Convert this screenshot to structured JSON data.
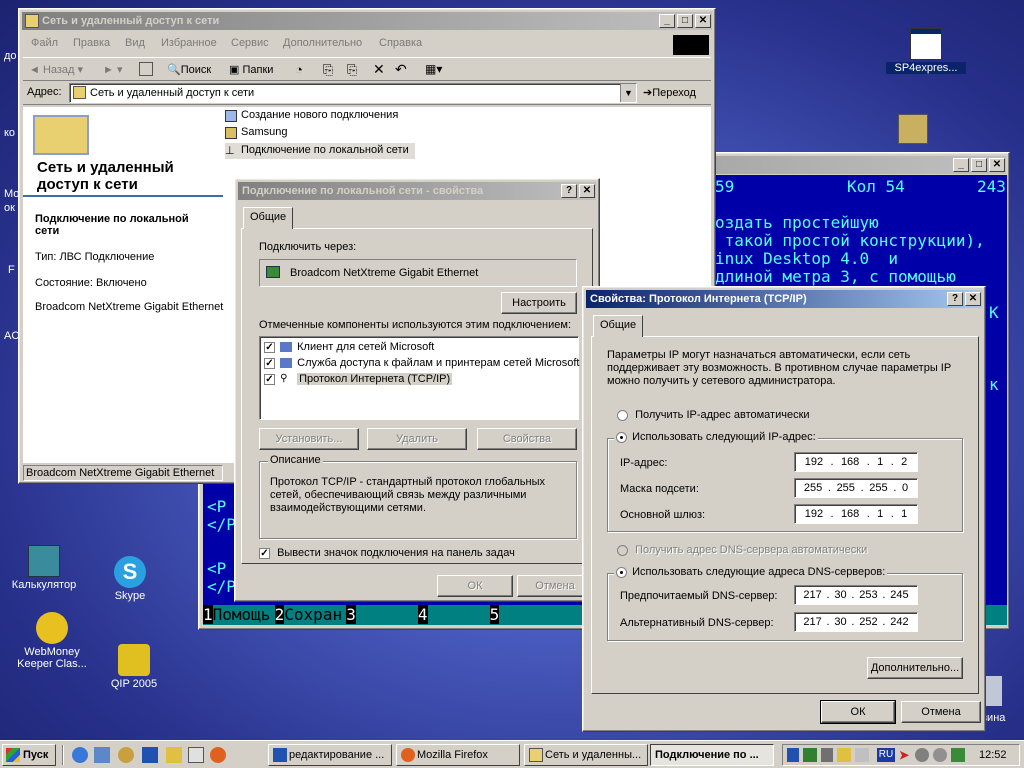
{
  "desktop": {
    "icons": [
      {
        "label": "SP4expres..."
      },
      {
        "label": "Калькулятор"
      },
      {
        "label": "Skype"
      },
      {
        "label": "WebMoney Keeper Clas..."
      },
      {
        "label": "QIP 2005"
      },
      {
        "label": "зина"
      }
    ],
    "left_edge_labels": [
      "до",
      "ко",
      "Мо",
      "ок",
      "F",
      "AC"
    ]
  },
  "explorer": {
    "title": "Сеть и удаленный доступ к сети",
    "menu": [
      "Файл",
      "Правка",
      "Вид",
      "Избранное",
      "Сервис",
      "Дополнительно",
      "Справка"
    ],
    "toolbar": {
      "back": "Назад",
      "search": "Поиск",
      "folders": "Папки"
    },
    "address_label": "Адрес:",
    "address_value": "Сеть и удаленный доступ к сети",
    "go_label": "Переход",
    "panel_title": "Сеть и удаленный доступ к сети",
    "selected_name": "Подключение по локальной сети",
    "type_line": "Тип: ЛВС Подключение",
    "state_line": "Состояние: Включено",
    "adapter_line": "Broadcom NetXtreme Gigabit Ethernet",
    "items": [
      {
        "label": "Создание нового подключения"
      },
      {
        "label": "Samsung"
      },
      {
        "label": "Подключение по локальной сети"
      }
    ],
    "status_text": "Broadcom NetXtreme Gigabit Ethernet"
  },
  "editor": {
    "status_line": {
      "pos": "59",
      "col": "Кол 54",
      "num": "243"
    },
    "lines": [
      "оздать простейшую",
      " такой простой конструкции),",
      "inux Desktop 4.0  и",
      "длиной метра 3, с помощью"
    ],
    "tag_lines": [
      "<P",
      "</P",
      "<P",
      "</P"
    ],
    "side_chars": [
      "К",
      "к"
    ],
    "fkeys": [
      {
        "num": "1",
        "label": "Помощь"
      },
      {
        "num": "2",
        "label": "Сохран"
      },
      {
        "num": "3",
        "label": ""
      },
      {
        "num": "4",
        "label": ""
      },
      {
        "num": "5",
        "label": ""
      }
    ]
  },
  "lan_props": {
    "title": "Подключение по локальной сети - свойства",
    "tab": "Общие",
    "connect_via_label": "Подключить через:",
    "adapter": "Broadcom NetXtreme Gigabit Ethernet",
    "configure_btn": "Настроить",
    "components_label": "Отмеченные компоненты используются этим подключением:",
    "components": [
      {
        "label": "Клиент для сетей Microsoft",
        "checked": true
      },
      {
        "label": "Служба доступа к файлам и принтерам сетей Microsoft",
        "checked": true
      },
      {
        "label": "Протокол Интернета (TCP/IP)",
        "checked": true
      }
    ],
    "install_btn": "Установить...",
    "remove_btn": "Удалить",
    "props_btn": "Свойства",
    "description_label": "Описание",
    "description": "Протокол TCP/IP - стандартный протокол глобальных сетей, обеспечивающий связь между различными взаимодействующими сетями.",
    "show_icon_label": "Вывести значок подключения на панель задач",
    "ok_btn": "ОК",
    "cancel_btn": "Отмена"
  },
  "tcpip": {
    "title": "Свойства: Протокол Интернета (TCP/IP)",
    "tab": "Общие",
    "intro": "Параметры IP могут назначаться автоматически, если сеть поддерживает эту возможность. В противном случае параметры IP можно получить у сетевого администратора.",
    "auto_ip_label": "Получить IP-адрес автоматически",
    "manual_ip_label": "Использовать следующий IP-адрес:",
    "ip_label": "IP-адрес:",
    "ip": [
      "192",
      "168",
      "1",
      "2"
    ],
    "mask_label": "Маска подсети:",
    "mask": [
      "255",
      "255",
      "255",
      "0"
    ],
    "gw_label": "Основной шлюз:",
    "gw": [
      "192",
      "168",
      "1",
      "1"
    ],
    "auto_dns_label": "Получить адрес DNS-сервера автоматически",
    "manual_dns_label": "Использовать следующие адреса DNS-серверов:",
    "dns1_label": "Предпочитаемый DNS-сервер:",
    "dns1": [
      "217",
      "30",
      "253",
      "245"
    ],
    "dns2_label": "Альтернативный DNS-сервер:",
    "dns2": [
      "217",
      "30",
      "252",
      "242"
    ],
    "advanced_btn": "Дополнительно...",
    "ok_btn": "ОК",
    "cancel_btn": "Отмена"
  },
  "taskbar": {
    "start": "Пуск",
    "tasks": [
      {
        "label": "редактирование ..."
      },
      {
        "label": "Mozilla Firefox"
      },
      {
        "label": "Сеть и удаленны..."
      },
      {
        "label": "Подключение по ..."
      }
    ],
    "lang": "RU",
    "clock": "12:52"
  },
  "colors": {
    "title_active": "#0a246a",
    "editor_bg": "#0000a8",
    "editor_text": "#55ffff",
    "editor_fkey_bg": "#008080"
  }
}
